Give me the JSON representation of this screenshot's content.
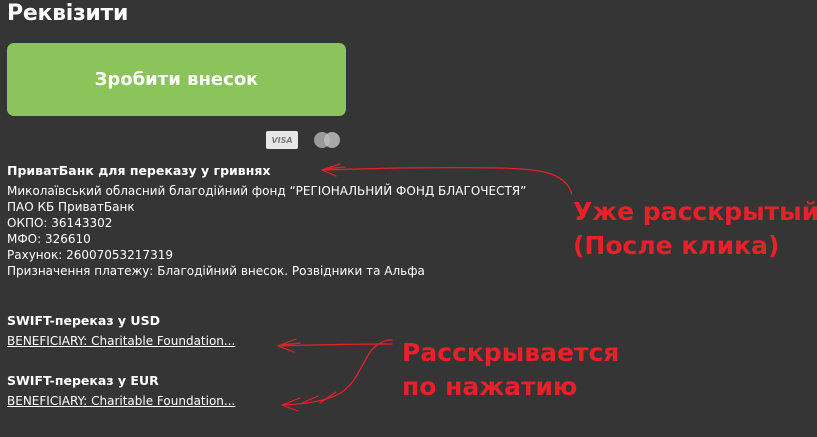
{
  "page": {
    "title": "Реквізити"
  },
  "donate": {
    "label": "Зробити внесок"
  },
  "payment_logos": {
    "visa": "VISA",
    "mastercard": "MasterCard"
  },
  "sections": [
    {
      "heading": "ПриватБанк для переказу у гривнях",
      "expanded": true,
      "lines": [
        "Миколаївський обласний благодійний фонд “РЕГІОНАЛЬНИЙ ФОНД БЛАГОЧЕСТЯ”",
        "ПАО КБ ПриватБанк",
        "ОКПО: 36143302",
        "МФО: 326610",
        "Рахунок: 26007053217319",
        "Призначення платежу: Благодійний внесок. Розвідники та Альфа"
      ]
    },
    {
      "heading": "SWIFT-переказ у USD",
      "expanded": false,
      "link": "BENEFICIARY: Charitable Foundation..."
    },
    {
      "heading": "SWIFT-переказ у EUR",
      "expanded": false,
      "link": "BENEFICIARY: Charitable Foundation..."
    }
  ],
  "annotations": {
    "expanded_note": [
      "Уже расскрытый",
      "(После клика)"
    ],
    "collapsed_note": [
      "Расскрывается",
      "по нажатию"
    ]
  },
  "colors": {
    "background": "#363535",
    "button": "#8bc45a",
    "annotation": "#e8202a"
  }
}
